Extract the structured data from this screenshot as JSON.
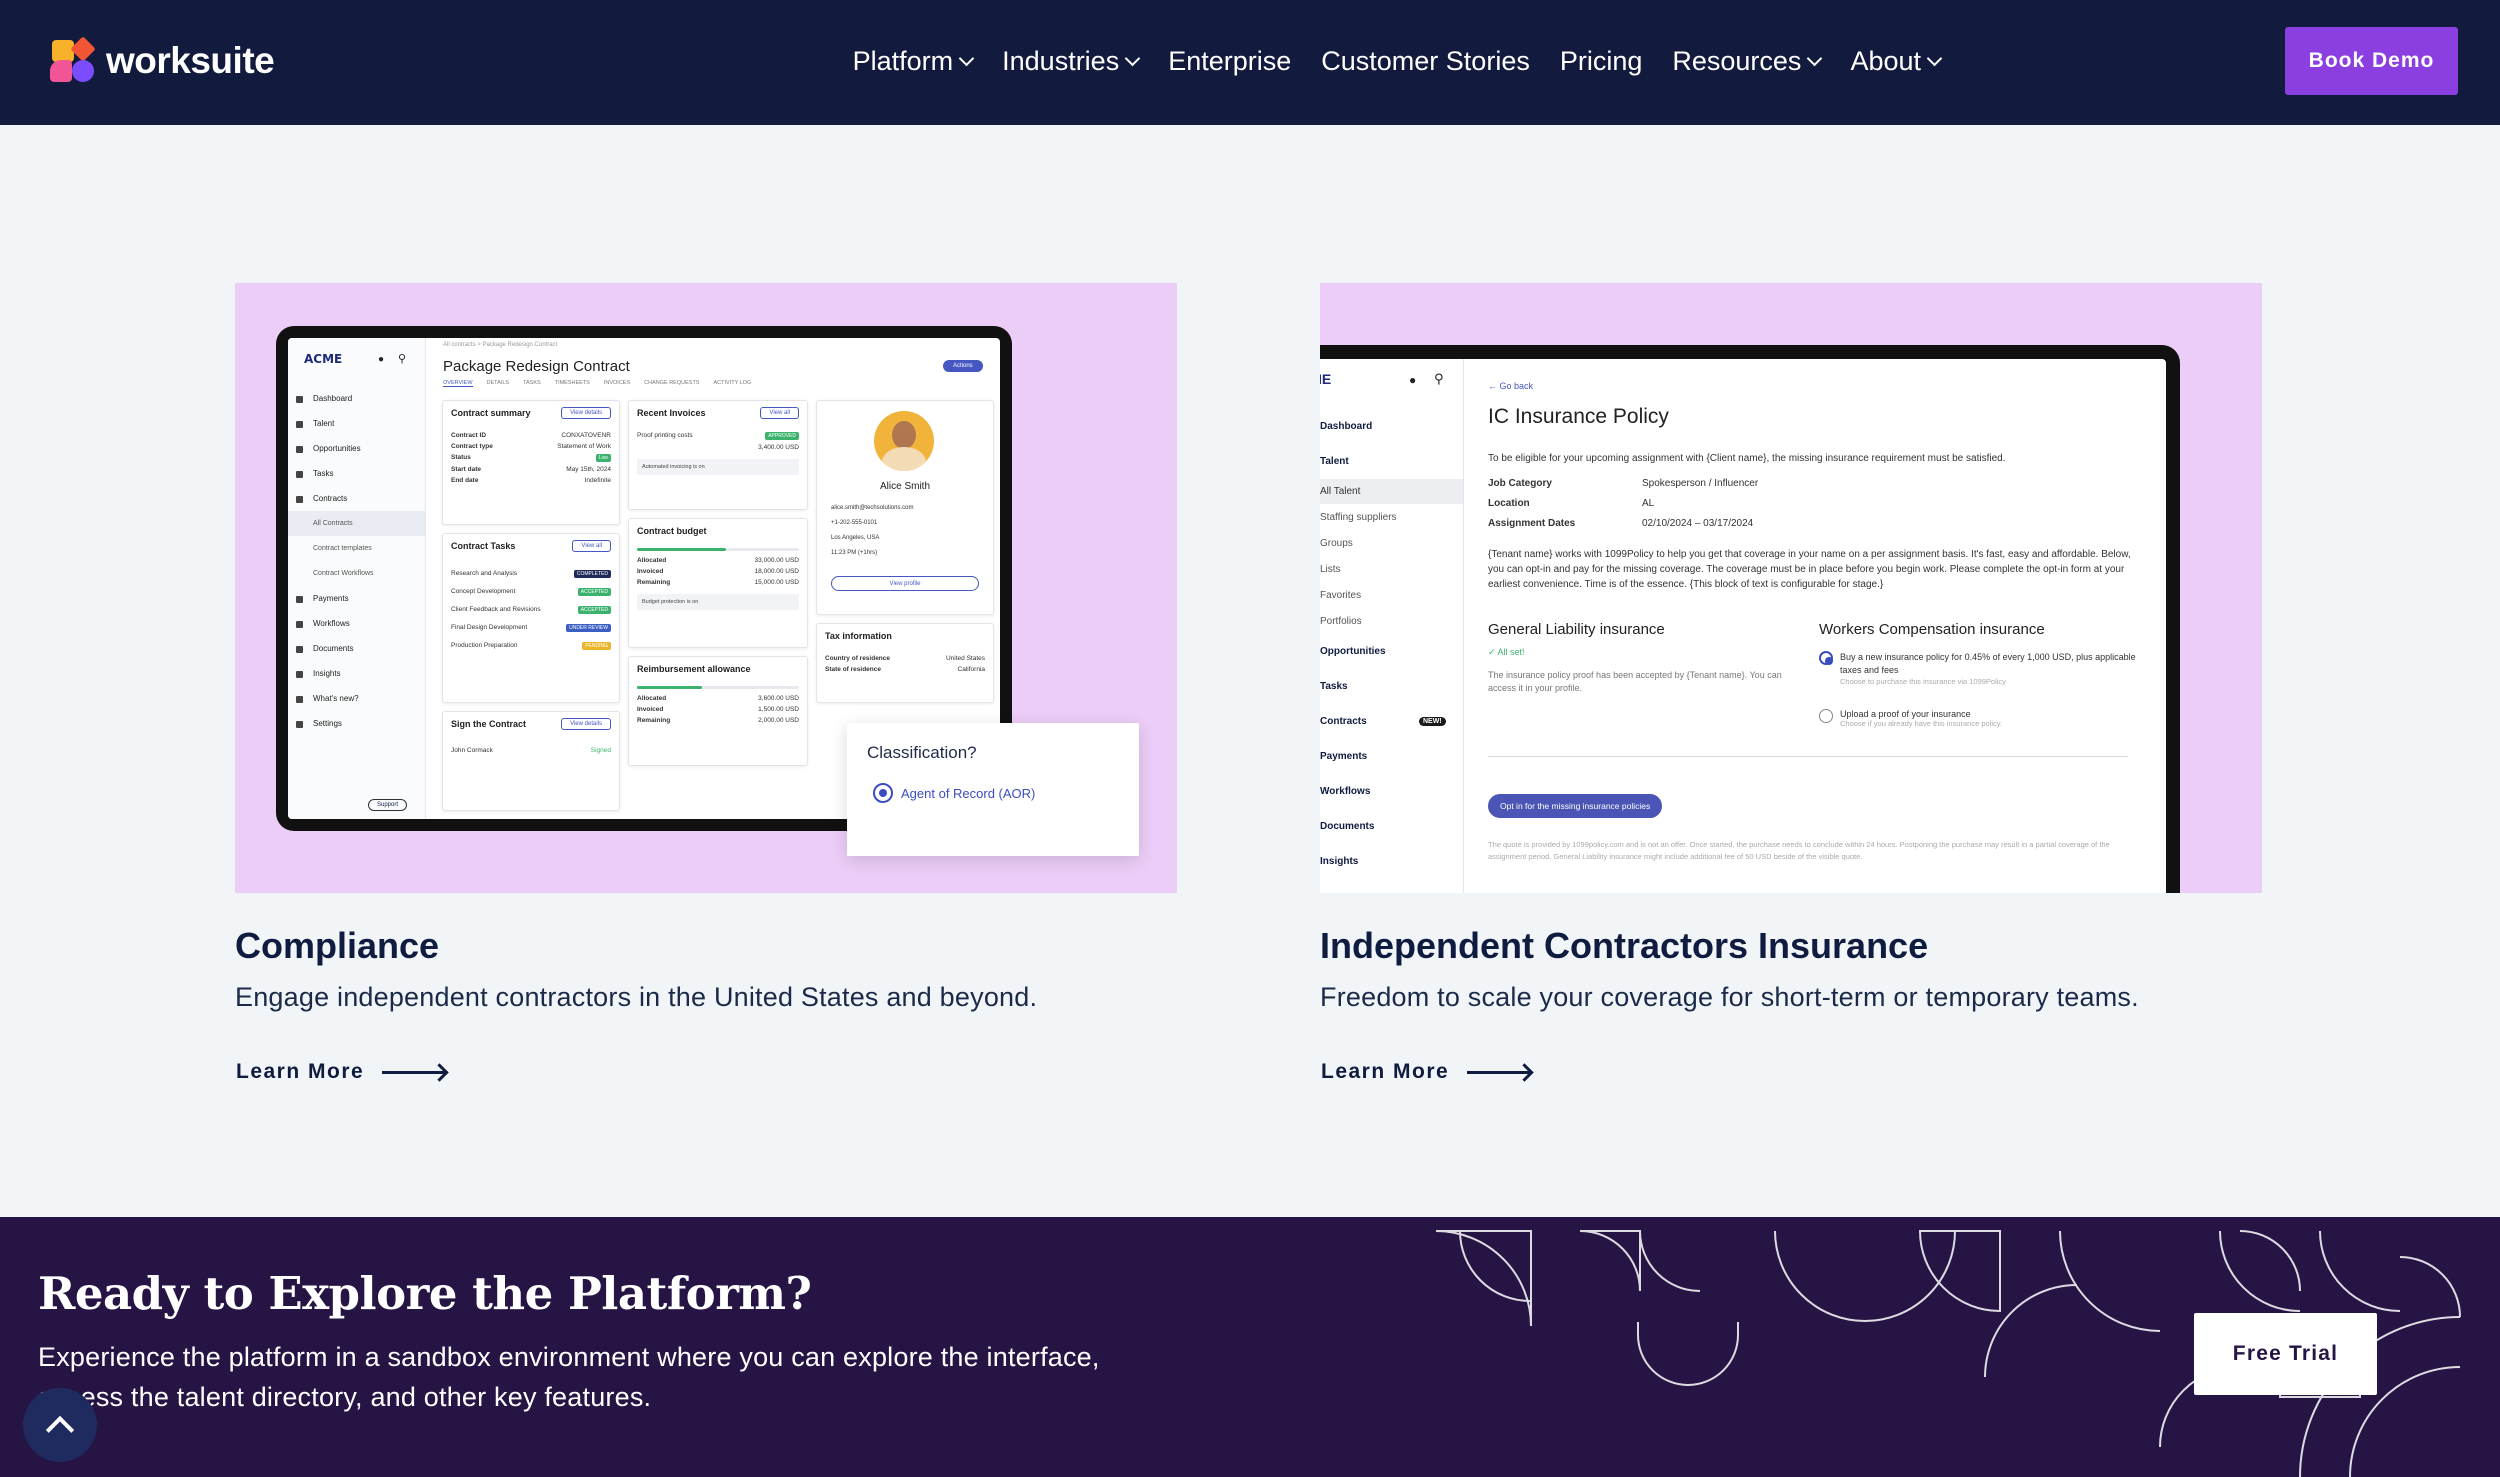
{
  "brand": {
    "name": "worksuite"
  },
  "nav": {
    "items": [
      {
        "label": "Platform",
        "dropdown": true
      },
      {
        "label": "Industries",
        "dropdown": true
      },
      {
        "label": "Enterprise",
        "dropdown": false
      },
      {
        "label": "Customer Stories",
        "dropdown": false
      },
      {
        "label": "Pricing",
        "dropdown": false
      },
      {
        "label": "Resources",
        "dropdown": true
      },
      {
        "label": "About",
        "dropdown": true
      }
    ],
    "cta": "Book Demo"
  },
  "cards": [
    {
      "title": "Compliance",
      "description": "Engage independent contractors in the United States and beyond.",
      "link": "Learn More",
      "mockup": {
        "logo": "ACME",
        "breadcrumb": "All contracts  >  Package Redesign Contract",
        "page_title": "Package Redesign Contract",
        "actions": "Actions",
        "tabs": [
          "OVERVIEW",
          "DETAILS",
          "TASKS",
          "TIMESHEETS",
          "INVOICES",
          "CHANGE REQUESTS",
          "ACTIVITY LOG"
        ],
        "sidebar": [
          "Dashboard",
          "Talent",
          "Opportunities",
          "Tasks",
          "Contracts",
          "All Contracts",
          "Contract templates",
          "Contract Workflows",
          "Payments",
          "Workflows",
          "Documents",
          "Insights",
          "What's new?",
          "Settings"
        ],
        "contract_summary": {
          "title": "Contract summary",
          "button": "View details",
          "rows": [
            [
              "Contract ID",
              "CONXATOVENR"
            ],
            [
              "Contract type",
              "Statement of Work"
            ],
            [
              "Status",
              "Live"
            ],
            [
              "Start date",
              "May 15th, 2024"
            ],
            [
              "End date",
              "Indefinite"
            ]
          ]
        },
        "contract_tasks": {
          "title": "Contract Tasks",
          "button": "View all",
          "items": [
            [
              "Research and Analysis",
              "COMPLETED"
            ],
            [
              "Concept Development",
              "ACCEPTED"
            ],
            [
              "Client Feedback and Revisions",
              "ACCEPTED"
            ],
            [
              "Final Design Development",
              "UNDER REVIEW"
            ],
            [
              "Production Preparation",
              "PENDING"
            ]
          ]
        },
        "sign_contract": {
          "title": "Sign the Contract",
          "button": "View details",
          "signer": "John Cormack",
          "status": "Signed"
        },
        "recent_invoices": {
          "title": "Recent Invoices",
          "button": "View all",
          "item": "Proof printing costs",
          "amount": "3,400.00 USD",
          "status": "APPROVED",
          "note": "Automated invoicing is on"
        },
        "contract_budget": {
          "title": "Contract budget",
          "rows": [
            [
              "Allocated",
              "33,000.00 USD"
            ],
            [
              "Invoiced",
              "18,000.00 USD"
            ],
            [
              "Remaining",
              "15,000.00 USD"
            ]
          ],
          "fill_pct": 55,
          "note": "Budget protection is on"
        },
        "reimbursement": {
          "title": "Reimbursement allowance",
          "rows": [
            [
              "Allocated",
              "3,600.00 USD"
            ],
            [
              "Invoiced",
              "1,500.00 USD"
            ],
            [
              "Remaining",
              "2,000.00 USD"
            ]
          ],
          "fill_pct": 40
        },
        "profile": {
          "name": "Alice Smith",
          "email": "alice.smith@techsolutions.com",
          "phone": "+1-202-555-0101",
          "location": "Los Angeles, USA",
          "time": "11:23 PM (+1hrs)",
          "button": "View profile"
        },
        "tax": {
          "title": "Tax information",
          "rows": [
            [
              "Country of residence",
              "United States"
            ],
            [
              "State of residence",
              "California"
            ]
          ]
        },
        "support": "Support",
        "classification": {
          "question": "Classification?",
          "option": "Agent of Record (AOR)"
        }
      }
    },
    {
      "title": "Independent Contractors Insurance",
      "description": "Freedom to scale your coverage for short-term or temporary teams.",
      "link": "Learn More",
      "mockup": {
        "sidebar": [
          "Dashboard",
          "Talent",
          "All Talent",
          "Staffing suppliers",
          "Groups",
          "Lists",
          "Favorites",
          "Portfolios",
          "Opportunities",
          "Tasks",
          "Contracts",
          "Payments",
          "Workflows",
          "Documents",
          "Insights"
        ],
        "new_badge": "NEW!",
        "go_back": "Go back",
        "page_title": "IC Insurance Policy",
        "intro": "To be eligible for your upcoming assignment with {Client name}, the missing insurance requirement must be satisfied.",
        "details": [
          [
            "Job Category",
            "Spokesperson / Influencer"
          ],
          [
            "Location",
            "AL"
          ],
          [
            "Assignment Dates",
            "02/10/2024 – 03/17/2024"
          ]
        ],
        "paragraph": "{Tenant name} works with 1099Policy to help you get that coverage in your name on a per assignment basis. It's fast, easy and affordable. Below, you can opt-in and pay for the missing coverage. The coverage must be in place before you begin work. Please complete the opt-in form at your earliest convenience. Time is of the essence. {This block of text is configurable for stage.}",
        "general": {
          "title": "General Liability insurance",
          "status": "All set!",
          "text": "The insurance policy proof has been accepted by {Tenant name}. You can access it in your profile."
        },
        "workers": {
          "title": "Workers Compensation insurance",
          "option1": "Buy a new insurance policy for 0.45% of every 1,000 USD, plus applicable taxes and fees",
          "option1_hint": "Choose to purchase this insurance via 1099Policy",
          "option2": "Upload a proof of your insurance",
          "option2_hint": "Choose if you already have this insurance policy."
        },
        "opt_in": "Opt in for the missing insurance policies",
        "footnote": "The quote is provided by 1099policy.com and is not an offer. Once started, the purchase needs to conclude within 24 hours. Postponing the purchase may result in a partial coverage of the assignment period. General Liability insurance might include additional fee of 50 USD beside of the visible quote."
      }
    }
  ],
  "cta": {
    "title": "Ready to Explore the Platform?",
    "description": "Experience the platform in a sandbox environment where you can explore the interface, access the talent directory, and other key features.",
    "button": "Free Trial"
  },
  "colors": {
    "nav_bg": "#121a3e",
    "accent": "#8b3fe0",
    "card_bg": "#eccdf7",
    "cta_bg": "#261544",
    "page_bg": "#f2f5f7"
  },
  "icons": [
    "chevron-down-icon",
    "arrow-right-icon",
    "chevron-up-icon",
    "bell-icon",
    "search-icon",
    "radio-selected-icon"
  ]
}
